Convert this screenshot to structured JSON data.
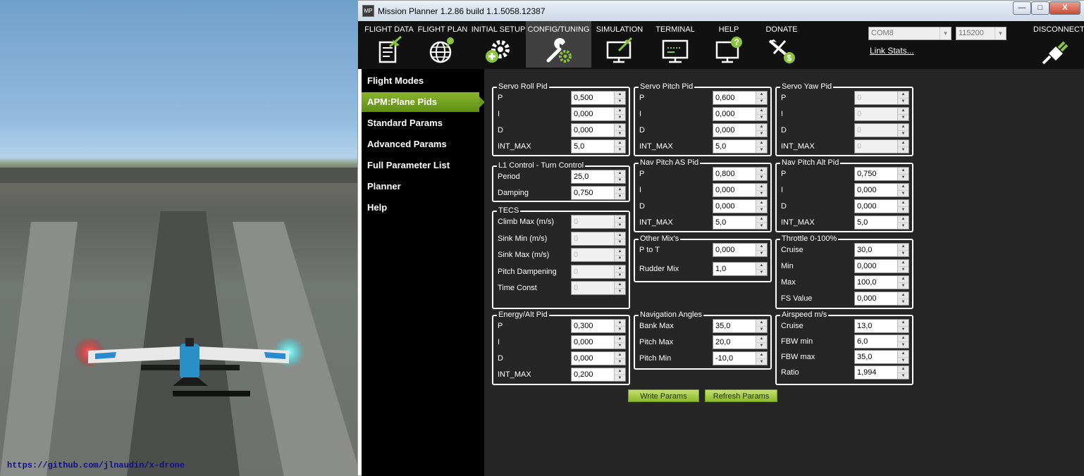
{
  "sim": {
    "url": "https://github.com/jlnaudin/x-drone"
  },
  "window": {
    "title": "Mission Planner 1.2.86 build 1.1.5058.12387",
    "app_icon": "MP",
    "min": "—",
    "max": "□",
    "close": "X"
  },
  "menu": {
    "tabs": [
      {
        "label": "FLIGHT DATA",
        "icon": "flight-data-icon"
      },
      {
        "label": "FLIGHT PLAN",
        "icon": "flight-plan-icon"
      },
      {
        "label": "INITIAL SETUP",
        "icon": "initial-setup-icon"
      },
      {
        "label": "CONFIG/TUNING",
        "icon": "config-tuning-icon"
      },
      {
        "label": "SIMULATION",
        "icon": "simulation-icon"
      },
      {
        "label": "TERMINAL",
        "icon": "terminal-icon"
      },
      {
        "label": "HELP",
        "icon": "help-icon"
      },
      {
        "label": "DONATE",
        "icon": "donate-icon"
      }
    ],
    "port": "COM8",
    "baud": "115200",
    "link_stats": "Link Stats...",
    "disconnect": "DISCONNECT"
  },
  "sidebar": {
    "items": [
      "Flight Modes",
      "APM:Plane Pids",
      "Standard Params",
      "Advanced Params",
      "Full Parameter List",
      "Planner",
      "Help"
    ],
    "active": "APM:Plane Pids"
  },
  "groups": {
    "servo_roll": {
      "title": "Servo Roll Pid",
      "rows": [
        [
          "P",
          "0,500"
        ],
        [
          "I",
          "0,000"
        ],
        [
          "D",
          "0,000"
        ],
        [
          "INT_MAX",
          "5,0"
        ]
      ]
    },
    "servo_pitch": {
      "title": "Servo Pitch Pid",
      "rows": [
        [
          "P",
          "0,600"
        ],
        [
          "I",
          "0,000"
        ],
        [
          "D",
          "0,000"
        ],
        [
          "INT_MAX",
          "5,0"
        ]
      ]
    },
    "servo_yaw": {
      "title": "Servo Yaw Pid",
      "rows": [
        [
          "P",
          "0"
        ],
        [
          "I",
          "0"
        ],
        [
          "D",
          "0"
        ],
        [
          "INT_MAX",
          "0"
        ]
      ]
    },
    "l1": {
      "title": "L1 Control - Turn Control",
      "rows": [
        [
          "Period",
          "25,0"
        ],
        [
          "Damping",
          "0,750"
        ]
      ]
    },
    "nav_pitch_as": {
      "title": "Nav Pitch AS Pid",
      "rows": [
        [
          "P",
          "0,800"
        ],
        [
          "I",
          "0,000"
        ],
        [
          "D",
          "0,000"
        ],
        [
          "INT_MAX",
          "5,0"
        ]
      ]
    },
    "nav_pitch_alt": {
      "title": "Nav Pitch Alt Pid",
      "rows": [
        [
          "P",
          "0,750"
        ],
        [
          "I",
          "0,000"
        ],
        [
          "D",
          "0,000"
        ],
        [
          "INT_MAX",
          "5,0"
        ]
      ]
    },
    "tecs": {
      "title": "TECS",
      "rows": [
        [
          "Climb Max (m/s)",
          "0"
        ],
        [
          "Sink Min (m/s)",
          "0"
        ],
        [
          "Sink Max (m/s)",
          "0"
        ],
        [
          "Pitch Dampening",
          "0"
        ],
        [
          "Time Const",
          "0"
        ]
      ]
    },
    "other_mix": {
      "title": "Other Mix's",
      "rows": [
        [
          "P to T",
          "0,000"
        ],
        [
          "Rudder Mix",
          "1,0"
        ]
      ]
    },
    "throttle": {
      "title": "Throttle 0-100%",
      "rows": [
        [
          "Cruise",
          "30,0"
        ],
        [
          "Min",
          "0,000"
        ],
        [
          "Max",
          "100,0"
        ],
        [
          "FS Value",
          "0,000"
        ]
      ]
    },
    "energy_alt": {
      "title": "Energy/Alt Pid",
      "rows": [
        [
          "P",
          "0,300"
        ],
        [
          "I",
          "0,000"
        ],
        [
          "D",
          "0,000"
        ],
        [
          "INT_MAX",
          "0,200"
        ]
      ]
    },
    "nav_angles": {
      "title": "Navigation Angles",
      "rows": [
        [
          "Bank Max",
          "35,0"
        ],
        [
          "Pitch Max",
          "20,0"
        ],
        [
          "Pitch Min",
          "-10,0"
        ]
      ]
    },
    "airspeed": {
      "title": "Airspeed m/s",
      "rows": [
        [
          "Cruise",
          "13,0"
        ],
        [
          "FBW min",
          "6,0"
        ],
        [
          "FBW max",
          "35,0"
        ],
        [
          "Ratio",
          "1,994"
        ]
      ]
    }
  },
  "buttons": {
    "write": "Write Params",
    "refresh": "Refresh Params"
  },
  "colors": {
    "accent": "#7aa51f",
    "panel": "#262626",
    "sidebar": "#000000"
  }
}
